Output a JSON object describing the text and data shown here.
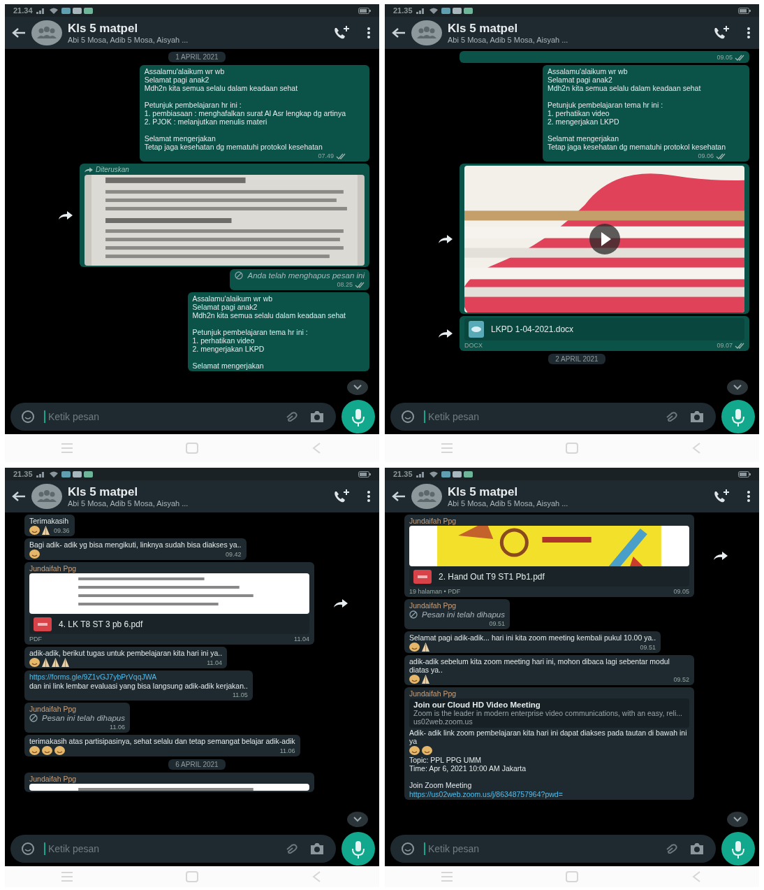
{
  "phones": [
    {
      "status": {
        "time": "21.34"
      },
      "header": {
        "title": "Kls 5 matpel",
        "subtitle": "Abi 5 Mosa, Adib 5 Mosa, Aisyah ..."
      },
      "composer": {
        "placeholder": "Ketik pesan"
      },
      "scroll_down_button": true,
      "messages": [
        {
          "kind": "date",
          "text": "1 APRIL 2021"
        },
        {
          "kind": "text",
          "outgoing": true,
          "text": "Assalamu'alaikum wr wb\nSelamat pagi anak2\nMdh2n kita semua selalu dalam keadaan sehat\n\nPetunjuk pembelajaran hr ini :\n1. pembiasaan : menghafalkan surat Al Asr lengkap dg artinya\n2. PJOK : melanjutkan menulis materi\n\nSelamat mengerjakan\nTetap jaga kesehatan dg mematuhi protokol kesehatan",
          "time": "07.49"
        },
        {
          "outgoing": true,
          "forwarded_label": "Diteruskan",
          "share": true
        },
        {
          "kind": "deleted",
          "outgoing": true,
          "text": "Anda telah menghapus pesan ini",
          "time": "08.25"
        },
        {
          "kind": "text",
          "outgoing": true,
          "text": "Assalamu'alaikum wr wb\nSelamat pagi anak2\nMdh2n kita semua selalu dalam keadaan sehat\n\nPetunjuk pembelajaran tema hr ini :\n1. perhatikan video\n2. mengerjakan LKPD\n\nSelamat mengerjakan"
        }
      ]
    },
    {
      "status": {
        "time": "21.35"
      },
      "header": {
        "title": "Kls 5 matpel",
        "subtitle": "Abi 5 Mosa, Adib 5 Mosa, Aisyah ..."
      },
      "composer": {
        "placeholder": "Ketik pesan"
      },
      "scroll_down_button": true,
      "messages": [
        {
          "kind": "text",
          "outgoing": true,
          "time": "09.05"
        },
        {
          "kind": "text",
          "outgoing": true,
          "text": "Assalamu'alaikum wr wb\nSelamat pagi anak2\nMdh2n kita semua selalu dalam keadaan sehat\n\nPetunjuk pembelajaran tema hr ini :\n1. perhatikan video\n2. mengerjakan LKPD\n\nSelamat mengerjakan\nTetap jaga kesehatan dg mematuhi protokol kesehatan",
          "time": "09.06"
        },
        {
          "kind": "video",
          "outgoing": true,
          "share": true
        },
        {
          "kind": "document",
          "outgoing": true,
          "file": {
            "kind": "doc",
            "name": "LKPD 1-04-2021.docx",
            "meta": "DOCX"
          },
          "time": "09.07",
          "share": true
        },
        {
          "kind": "date",
          "text": "2 APRIL 2021"
        }
      ]
    },
    {
      "status": {
        "time": "21.35"
      },
      "header": {
        "title": "Kls 5 matpel",
        "subtitle": "Abi 5 Mosa, Adib 5 Mosa, Aisyah ..."
      },
      "composer": {
        "placeholder": "Ketik pesan"
      },
      "scroll_down_button": true,
      "messages": [
        {
          "kind": "text",
          "outgoing": false,
          "text": "Terimakasih",
          "emojis": [
            {
              "kind": "smile"
            },
            {
              "kind": "pray"
            }
          ],
          "time": "09.36"
        },
        {
          "kind": "text",
          "outgoing": false,
          "text": "Bagi adik- adik yg bisa mengikuti, linknya sudah bisa diakses ya..",
          "emojis": [
            {
              "kind": "smile"
            }
          ],
          "time": "09.42"
        },
        {
          "kind": "document",
          "outgoing": false,
          "sender": "Jundaifah Ppg",
          "file": {
            "kind": "pdf",
            "name": "4. LK T8 ST 3 pb 6.pdf",
            "meta": "PDF"
          },
          "time": "11.04",
          "share": true
        },
        {
          "kind": "text",
          "outgoing": false,
          "text": "adik-adik, berikut tugas untuk pembelajaran kita hari ini ya..",
          "emojis": [
            {
              "kind": "smile"
            },
            {
              "kind": "pray"
            },
            {
              "kind": "pray"
            },
            {
              "kind": "pray"
            }
          ],
          "time": "11.04"
        },
        {
          "kind": "text",
          "outgoing": false,
          "link": "https://forms.gle/9Z1vGJ7ybPrVqqJWA",
          "text": "dan ini link lembar evaluasi yang bisa langsung adik-adik kerjakan..",
          "time": "11.05"
        },
        {
          "kind": "deleted",
          "outgoing": false,
          "sender": "Jundaifah Ppg",
          "text": "Pesan ini telah dihapus",
          "time": "11.06"
        },
        {
          "kind": "text",
          "outgoing": false,
          "text": "terimakasih atas partisipasinya, sehat selalu dan tetap semangat belajar adik-adik",
          "emojis": [
            {
              "kind": "smile"
            },
            {
              "kind": "smile"
            },
            {
              "kind": "smile"
            }
          ],
          "time": "11.06"
        },
        {
          "kind": "date",
          "text": "6 APRIL 2021"
        },
        {
          "outgoing": false,
          "sender": "Jundaifah Ppg"
        }
      ]
    },
    {
      "status": {
        "time": "21.35"
      },
      "header": {
        "title": "Kls 5 matpel",
        "subtitle": "Abi 5 Mosa, Adib 5 Mosa, Aisyah ..."
      },
      "composer": {
        "placeholder": "Ketik pesan"
      },
      "scroll_down_button": true,
      "messages": [
        {
          "kind": "document",
          "outgoing": false,
          "sender": "Jundaifah Ppg",
          "file": {
            "kind": "pdf",
            "name": "2. Hand Out T9 ST1 Pb1.pdf",
            "meta": "19 halaman • PDF"
          },
          "time": "09.05",
          "share": true
        },
        {
          "kind": "deleted",
          "outgoing": false,
          "sender": "Jundaifah Ppg",
          "text": "Pesan ini telah dihapus",
          "time": "09.51"
        },
        {
          "kind": "text",
          "outgoing": false,
          "text": "Selamat pagi adik-adik... hari ini kita zoom meeting kembali pukul 10.00 ya..",
          "emojis": [
            {
              "kind": "smile"
            },
            {
              "kind": "pray"
            }
          ],
          "time": "09.51"
        },
        {
          "kind": "text",
          "outgoing": false,
          "text": "adik-adik sebelum kita zoom meeting hari ini, mohon dibaca lagi sebentar modul diatas ya..",
          "emojis": [
            {
              "kind": "smile"
            },
            {
              "kind": "pray"
            }
          ],
          "time": "09.52"
        },
        {
          "kind": "text",
          "outgoing": false,
          "sender": "Jundaifah Ppg",
          "link_title": "Join our Cloud HD Video Meeting",
          "link_desc": "Zoom is the leader in modern enterprise video communications, with an easy, reli...",
          "link_domain": "us02web.zoom.us",
          "text": "Adik- adik link zoom pembelajaran kita hari ini dapat diakses pada tautan di bawah ini ya",
          "emojis": [
            {
              "kind": "smile"
            },
            {
              "kind": "smile"
            }
          ],
          "text_after": "Topic: PPL PPG UMM\nTime: Apr 6, 2021 10:00 AM Jakarta\n\nJoin Zoom Meeting",
          "link_after": "https://us02web.zoom.us/j/86348757964?pwd="
        }
      ]
    }
  ]
}
